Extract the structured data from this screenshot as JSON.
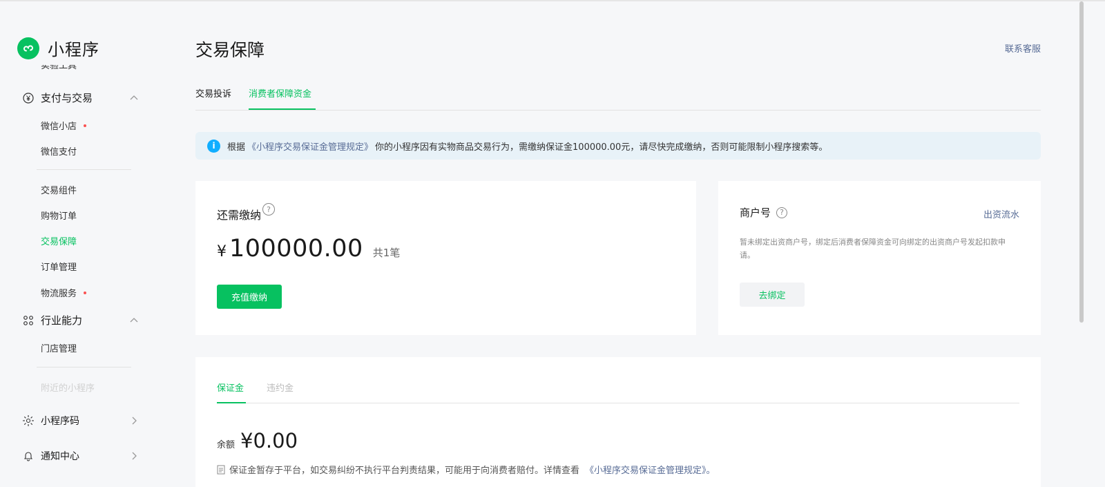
{
  "sidebar": {
    "app_name": "小程序",
    "cut_item": "实验工具",
    "groups": [
      {
        "label": "支付与交易",
        "icon": "yen-circle-icon"
      },
      {
        "label": "行业能力",
        "icon": "nodes-icon"
      },
      {
        "label": "小程序码",
        "icon": "sun-code-icon"
      },
      {
        "label": "通知中心",
        "icon": "bell-icon"
      }
    ],
    "items": {
      "weixin_shop": "微信小店",
      "weixin_pay": "微信支付",
      "trade_component": "交易组件",
      "shopping_order": "购物订单",
      "trade_guarantee": "交易保障",
      "order_manage": "订单管理",
      "logistics": "物流服务",
      "store_manage": "门店管理",
      "nearby": "附近的小程序"
    }
  },
  "header": {
    "title": "交易保障",
    "contact": "联系客服"
  },
  "tabs": [
    "交易投诉",
    "消费者保障资金"
  ],
  "notice": {
    "prefix": "根据",
    "link": "《小程序交易保证金管理规定》",
    "text": "你的小程序因有实物商品交易行为，需缴纳保证金100000.00元，请尽快完成缴纳，否则可能限制小程序搜索等。"
  },
  "due_card": {
    "label": "还需缴纳",
    "currency": "¥",
    "amount": "100000.00",
    "count": "共1笔",
    "button": "充值缴纳"
  },
  "merchant_card": {
    "label": "商户号",
    "link": "出资流水",
    "desc": "暂未绑定出资商户号，绑定后消费者保障资金可向绑定的出资商户号发起扣款申请。",
    "button": "去绑定"
  },
  "deposit_card": {
    "tabs": [
      "保证金",
      "违约金"
    ],
    "balance_label": "余额",
    "balance_value": "¥0.00",
    "footnote": "保证金暂存于平台，如交易纠纷不执行平台判责结果，可能用于向消费者赔付。详情查看",
    "footnote_link": "《小程序交易保证金管理规定》。"
  },
  "colors": {
    "accent": "#07c160",
    "link": "#576b95",
    "notice_bg": "#e8f2f8",
    "info": "#10aeff",
    "red_dot": "#fa5151"
  }
}
